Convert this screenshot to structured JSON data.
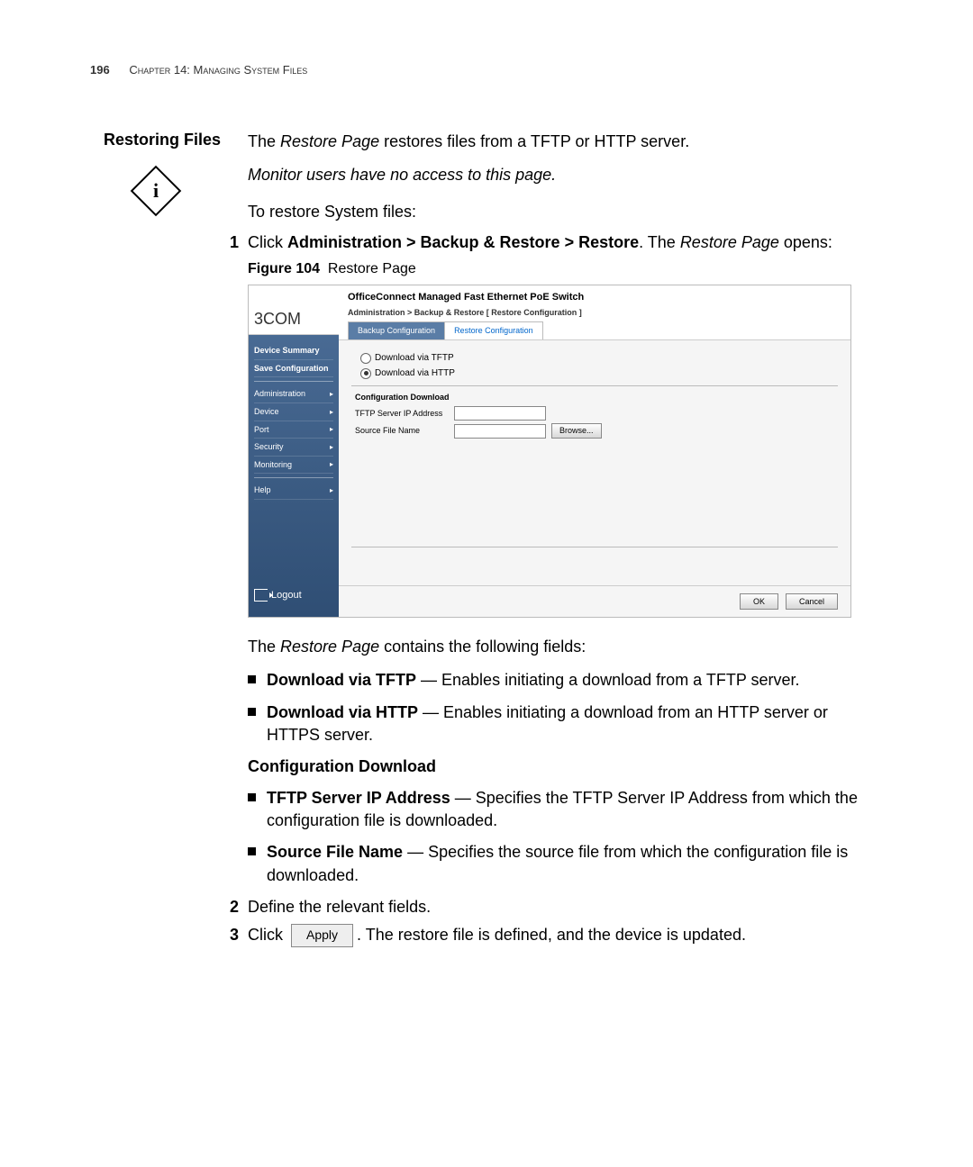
{
  "header": {
    "page_num": "196",
    "chapter": "Chapter 14: Managing System Files"
  },
  "section": {
    "title": "Restoring Files",
    "intro_pre": "The ",
    "intro_em": "Restore Page",
    "intro_post": " restores files from a TFTP or HTTP server.",
    "note": "Monitor users have no access to this page.",
    "lead": "To restore System files:",
    "step1_pre": "Click ",
    "step1_bold": "Administration > Backup & Restore > Restore",
    "step1_mid": ". The ",
    "step1_em": "Restore Page",
    "step1_post": " opens:",
    "figure_label": "Figure 104",
    "figure_caption": "Restore Page",
    "after_fig_pre": "The ",
    "after_fig_em": "Restore Page",
    "after_fig_post": " contains the following fields:",
    "bullets1": [
      {
        "bold": "Download via TFTP",
        "rest": " — Enables initiating a download from a TFTP server."
      },
      {
        "bold": "Download via HTTP",
        "rest": " — Enables initiating a download from an HTTP server or HTTPS server."
      }
    ],
    "subhead": "Configuration Download",
    "bullets2": [
      {
        "bold": "TFTP Server IP Address",
        "rest": " — Specifies the TFTP Server IP Address from which the configuration file is downloaded."
      },
      {
        "bold": "Source File Name",
        "rest": " — Specifies the source file from which the configuration file is downloaded."
      }
    ],
    "step2": "Define the relevant fields.",
    "step3_pre": "Click ",
    "step3_btn": "Apply",
    "step3_post": ". The restore file is defined, and the device is updated."
  },
  "ui": {
    "logo": "3COM",
    "title": "OfficeConnect Managed Fast Ethernet PoE Switch",
    "breadcrumb": "Administration > Backup & Restore [ Restore Configuration ]",
    "sidebar": {
      "summary": "Device Summary",
      "save": "Save Configuration",
      "admin": "Administration",
      "device": "Device",
      "port": "Port",
      "security": "Security",
      "monitoring": "Monitoring",
      "help": "Help",
      "logout": "Logout"
    },
    "tabs": {
      "backup": "Backup Configuration",
      "restore": "Restore Configuration"
    },
    "radios": {
      "tftp": "Download via TFTP",
      "http": "Download via HTTP"
    },
    "section_title": "Configuration Download",
    "labels": {
      "tftp_ip": "TFTP Server IP Address",
      "source": "Source File Name"
    },
    "buttons": {
      "browse": "Browse...",
      "ok": "OK",
      "cancel": "Cancel"
    }
  }
}
